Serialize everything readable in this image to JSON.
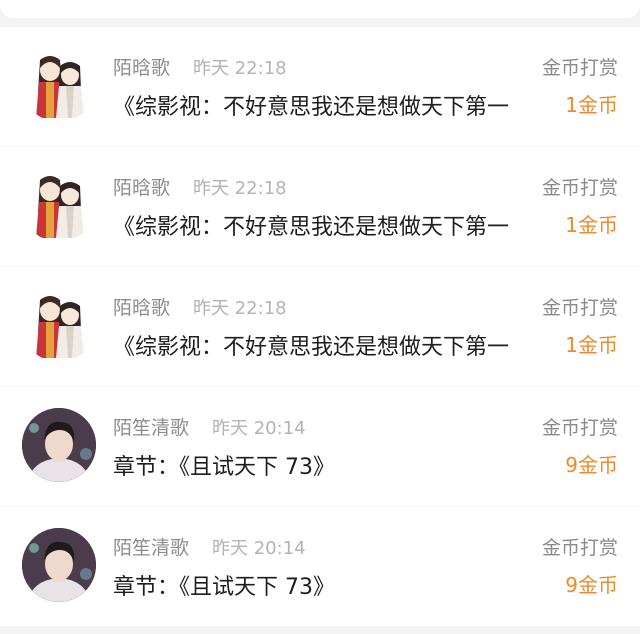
{
  "colors": {
    "background": "#f4f4f4",
    "card": "#ffffff",
    "name_text": "#8d8d8d",
    "time_text": "#b3b3b3",
    "content_text": "#1e1e1e",
    "amount_accent": "#ee8a2c"
  },
  "rewards": [
    {
      "avatar_icon": "chibi-couple-avatar-icon",
      "name": "陌晗歌",
      "time": "昨天 22:18",
      "content": "《综影视：不好意思我还是想做天下第一",
      "type": "金币打赏",
      "amount": "1金币"
    },
    {
      "avatar_icon": "chibi-couple-avatar-icon",
      "name": "陌晗歌",
      "time": "昨天 22:18",
      "content": "《综影视：不好意思我还是想做天下第一",
      "type": "金币打赏",
      "amount": "1金币"
    },
    {
      "avatar_icon": "chibi-couple-avatar-icon",
      "name": "陌晗歌",
      "time": "昨天 22:18",
      "content": "《综影视：不好意思我还是想做天下第一",
      "type": "金币打赏",
      "amount": "1金币"
    },
    {
      "avatar_icon": "portrait-avatar-icon",
      "name": "陌笙清歌",
      "time": "昨天 20:14",
      "content": "章节：《且试天下 73》",
      "type": "金币打赏",
      "amount": "9金币"
    },
    {
      "avatar_icon": "portrait-avatar-icon",
      "name": "陌笙清歌",
      "time": "昨天 20:14",
      "content": "章节：《且试天下 73》",
      "type": "金币打赏",
      "amount": "9金币"
    }
  ]
}
